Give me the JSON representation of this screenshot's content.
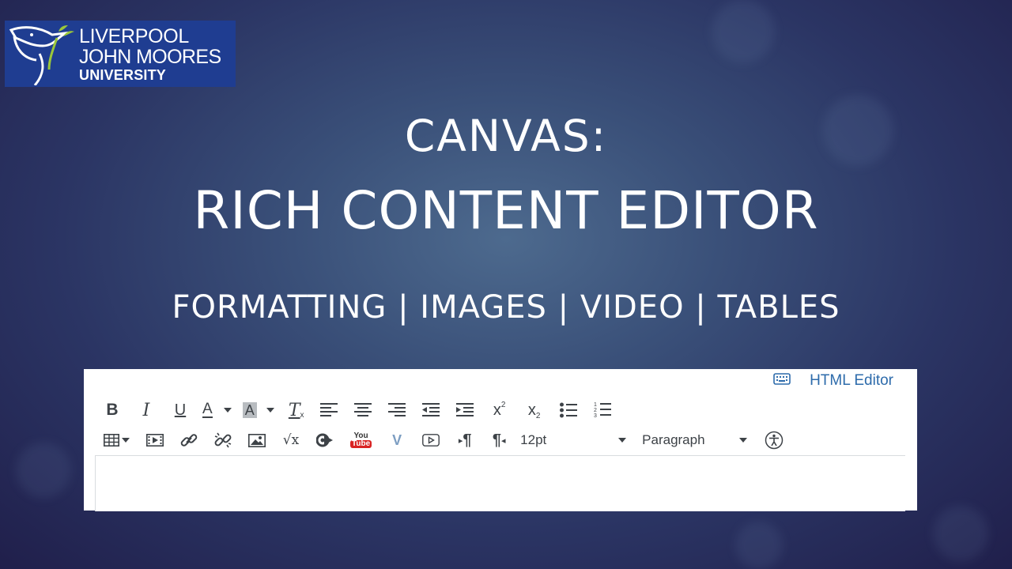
{
  "logo": {
    "line1": "LIVERPOOL",
    "line2": "JOHN MOORES",
    "line3": "UNIVERSITY",
    "bg_color": "#1f3d91",
    "accent_color": "#9bc73a"
  },
  "slide": {
    "title": "CANVAS:",
    "heading": "RICH CONTENT EDITOR",
    "subtitle": "FORMATTING | IMAGES | VIDEO | TABLES"
  },
  "editor": {
    "html_editor_label": "HTML Editor",
    "toolbar_row1": [
      {
        "name": "bold-icon",
        "label": "B"
      },
      {
        "name": "italic-icon",
        "label": "I"
      },
      {
        "name": "underline-icon",
        "label": "U"
      },
      {
        "name": "text-color-icon",
        "label": "A"
      },
      {
        "name": "background-color-icon",
        "label": "A"
      },
      {
        "name": "clear-formatting-icon",
        "label": "T"
      },
      {
        "name": "align-left-icon"
      },
      {
        "name": "align-center-icon"
      },
      {
        "name": "align-right-icon"
      },
      {
        "name": "outdent-icon"
      },
      {
        "name": "indent-icon"
      },
      {
        "name": "superscript-icon",
        "label": "x"
      },
      {
        "name": "subscript-icon",
        "label": "x"
      },
      {
        "name": "bullet-list-icon"
      },
      {
        "name": "numbered-list-icon"
      }
    ],
    "toolbar_row2": [
      {
        "name": "table-icon"
      },
      {
        "name": "media-icon"
      },
      {
        "name": "link-icon"
      },
      {
        "name": "unlink-icon"
      },
      {
        "name": "image-icon"
      },
      {
        "name": "math-equation-icon",
        "label": "√x"
      },
      {
        "name": "lti-tool-icon"
      },
      {
        "name": "youtube-icon",
        "label": "You Tube"
      },
      {
        "name": "vimeo-icon",
        "label": "V"
      },
      {
        "name": "record-media-icon"
      },
      {
        "name": "ltr-icon",
        "label": "¶"
      },
      {
        "name": "rtl-icon",
        "label": "¶"
      },
      {
        "name": "accessibility-icon"
      }
    ],
    "font_size": "12pt",
    "block_format": "Paragraph",
    "link_color": "#2d6bab"
  }
}
